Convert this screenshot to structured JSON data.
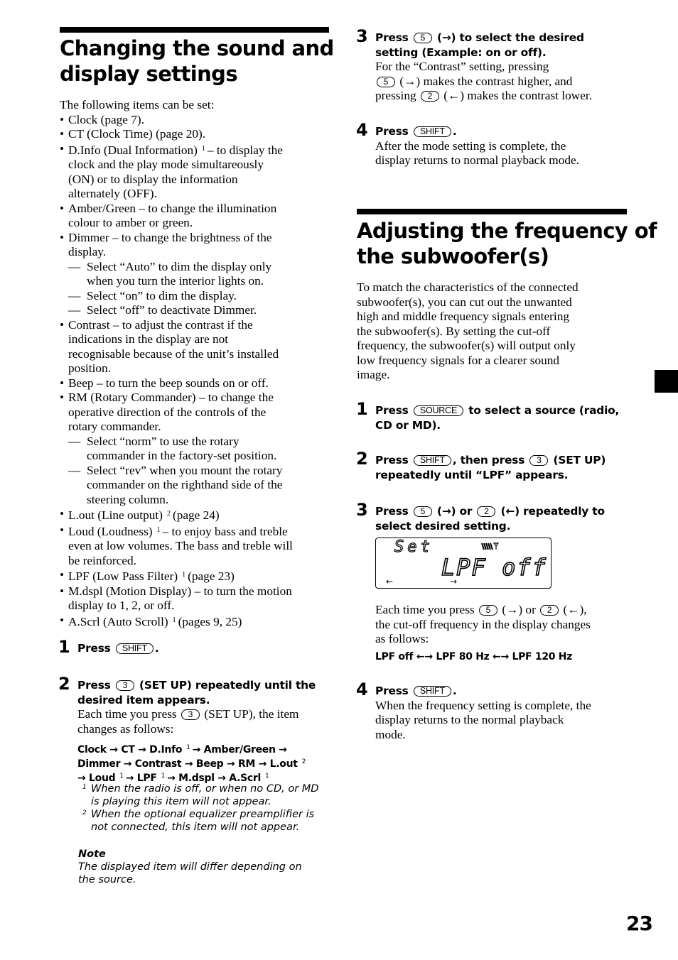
{
  "page_number": "23",
  "left": {
    "title_lines": [
      "Changing the sound and",
      "display settings"
    ],
    "intro": "The following items can be set:",
    "items": [
      {
        "lines": [
          "Clock (page 7)."
        ]
      },
      {
        "lines": [
          "CT (Clock Time) (page 20)."
        ]
      },
      {
        "pre": "D.Info (Dual Information)",
        "sup": "1",
        "post": "– to display the",
        "lines": [
          "clock and the play mode simultareously",
          "(ON) or to display the information",
          "alternately (OFF)."
        ]
      },
      {
        "lines": [
          "Amber/Green – to change the illumination",
          "colour to amber or green."
        ]
      },
      {
        "lines": [
          "Dimmer – to change the brightness of the",
          "display."
        ],
        "subs": [
          {
            "lines": [
              "Select “Auto” to dim the display only",
              "when you turn the interior lights on."
            ]
          },
          {
            "lines": [
              "Select “on” to dim the display."
            ]
          },
          {
            "lines": [
              "Select “off” to deactivate Dimmer."
            ]
          }
        ]
      },
      {
        "lines": [
          "Contrast – to adjust the contrast if the",
          "indications in the display are not",
          "recognisable because of the unit’s installed",
          "position."
        ]
      },
      {
        "lines": [
          "Beep – to turn the beep sounds on or off."
        ]
      },
      {
        "lines": [
          "RM (Rotary Commander) – to change the",
          "operative direction of the controls of the",
          "rotary commander."
        ],
        "subs": [
          {
            "lines": [
              "Select “norm” to use the rotary",
              "commander in the factory-set position."
            ]
          },
          {
            "lines": [
              "Select “rev” when you mount the rotary",
              "commander on the righthand side of the",
              "steering column."
            ]
          }
        ]
      },
      {
        "pre": "L.out (Line output)",
        "sup": "2",
        "post": "(page 24)"
      },
      {
        "pre": "Loud (Loudness)",
        "sup": "1",
        "post": "– to enjoy bass and treble",
        "lines": [
          "even at low volumes. The bass and treble will",
          "be reinforced."
        ]
      },
      {
        "pre": "LPF (Low Pass Filter)",
        "sup": "1",
        "post": "(page 23)"
      },
      {
        "lines": [
          "M.dspl (Motion Display) – to turn the motion",
          "display to 1, 2, or off."
        ]
      },
      {
        "pre": "A.Scrl (Auto Scroll)",
        "sup": "1",
        "post": "(pages 9, 25)"
      }
    ],
    "dash": "—",
    "step1": {
      "num": "1",
      "press": "Press",
      "key": "SHIFT",
      "end": "."
    },
    "step2": {
      "num": "2",
      "press": "Press",
      "key": "3",
      "title_rest": "(SET UP) repeatedly until the",
      "title_line2": "desired item appears.",
      "body_pre": "Each time you press",
      "body_key": "3",
      "body_post": "(SET UP), the item",
      "body_line2": "changes as follows:",
      "sequence_lines": [
        [
          {
            "t": "Clock → CT → D.Info"
          },
          {
            "s": "1"
          },
          {
            "t": "→ Amber/Green →"
          }
        ],
        [
          {
            "t": "Dimmer → Contrast → Beep → RM → L.out"
          },
          {
            "s": "2"
          }
        ],
        [
          {
            "t": "→ Loud"
          },
          {
            "s": "1"
          },
          {
            "t": "→ LPF"
          },
          {
            "s": "1"
          },
          {
            "t": "→ M.dspl → A.Scrl"
          },
          {
            "s": "1"
          }
        ]
      ]
    },
    "footnotes": [
      {
        "num": "1",
        "lines": [
          "When the radio is off, or when no CD, or MD",
          "is playing this item will not appear."
        ]
      },
      {
        "num": "2",
        "lines": [
          "When the optional equalizer preamplifier is",
          "not connected, this item will not appear."
        ]
      }
    ],
    "note": {
      "title": "Note",
      "lines": [
        "The displayed item will differ depending on",
        "the source."
      ]
    }
  },
  "right": {
    "step3": {
      "num": "3",
      "press": "Press",
      "key": "5",
      "title_rest": "(→) to select the desired",
      "title_line2": "setting (Example: on or off).",
      "body_line1": "For the “Contrast” setting, pressing",
      "body_key1": "5",
      "body_line2_rest": "(→) makes the contrast higher, and",
      "body_line3_pre": "pressing",
      "body_key2": "2",
      "body_line3_rest": "(←) makes the contrast lower."
    },
    "step4": {
      "num": "4",
      "press": "Press",
      "key": "SHIFT",
      "end": ".",
      "body_lines": [
        "After the mode setting is complete, the",
        "display returns to normal playback mode."
      ]
    },
    "title_lines": [
      "Adjusting the frequency of",
      "the subwoofer(s)"
    ],
    "intro_lines": [
      "To match the characteristics of the connected",
      "subwoofer(s), you can cut out the unwanted",
      "high and middle frequency signals entering",
      "the subwoofer(s). By setting the cut-off",
      "frequency, the subwoofer(s) will output only",
      "low frequency signals for a clearer sound",
      "image."
    ],
    "lpf_step1": {
      "num": "1",
      "press": "Press",
      "key": "SOURCE",
      "title_rest": "to select a source (radio,",
      "title_line2": "CD or MD)."
    },
    "lpf_step2": {
      "num": "2",
      "press": "Press",
      "key": "SHIFT",
      "mid": ", then press",
      "key2": "3",
      "title_rest": "(SET UP)",
      "title_line2": "repeatedly until “LPF” appears."
    },
    "lpf_step3": {
      "num": "3",
      "press": "Press",
      "key": "5",
      "mid": "(→) or",
      "key2": "2",
      "title_rest": "(←) repeatedly to",
      "title_line2": "select desired setting.",
      "display": {
        "top": "Set",
        "main": "LPF off",
        "icon": "signal-icon",
        "left_arrow": "←",
        "right_arrow": "→"
      },
      "body_pre": "Each time you press",
      "body_key1": "5",
      "body_mid": "(→) or",
      "body_key2": "2",
      "body_post": "(←),",
      "body_lines": [
        "the cut-off frequency in the display changes",
        "as follows:"
      ],
      "sequence": "LPF off ←→ LPF 80 Hz ←→ LPF 120 Hz"
    },
    "lpf_step4": {
      "num": "4",
      "press": "Press",
      "key": "SHIFT",
      "end": ".",
      "body_lines": [
        "When the frequency setting is complete, the",
        "display returns to the normal playback",
        "mode."
      ]
    }
  }
}
